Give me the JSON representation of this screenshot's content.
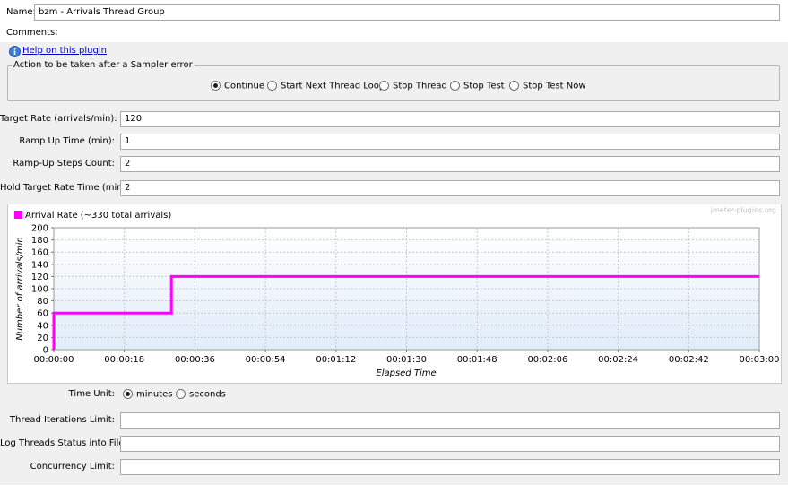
{
  "name": {
    "label": "Name:",
    "value": "bzm - Arrivals Thread Group"
  },
  "comments": {
    "label": "Comments:"
  },
  "help": {
    "link": "Help on this plugin"
  },
  "sampler_error": {
    "legend": "Action to be taken after a Sampler error",
    "options": [
      "Continue",
      "Start Next Thread Loop",
      "Stop Thread",
      "Stop Test",
      "Stop Test Now"
    ],
    "selected": "Continue"
  },
  "fields": {
    "target_rate": {
      "label": "Target Rate (arrivals/min):",
      "value": "120"
    },
    "ramp_up_time": {
      "label": "Ramp Up Time (min):",
      "value": "1"
    },
    "ramp_up_steps": {
      "label": "Ramp-Up Steps Count:",
      "value": "2"
    },
    "hold_time": {
      "label": "Hold Target Rate Time (min):",
      "value": "2"
    }
  },
  "chart": {
    "watermark": "jmeter-plugins.org"
  },
  "chart_data": {
    "type": "line",
    "legend": "Arrival Rate (~330 total arrivals)",
    "ylabel": "Number of arrivals/min",
    "xlabel": "Elapsed Time",
    "y_ticks": [
      "0",
      "20",
      "40",
      "60",
      "80",
      "100",
      "120",
      "140",
      "160",
      "180",
      "200"
    ],
    "x_ticks": [
      "00:00:00",
      "00:00:18",
      "00:00:36",
      "00:00:54",
      "00:01:12",
      "00:01:30",
      "00:01:48",
      "00:02:06",
      "00:02:24",
      "00:02:42",
      "00:03:00"
    ],
    "ylim": [
      0,
      200
    ],
    "xlim_seconds": [
      0,
      180
    ],
    "color": "#ff00ff",
    "series": [
      {
        "x_seconds": [
          0,
          0,
          30,
          30,
          180
        ],
        "values": [
          0,
          60,
          60,
          120,
          120
        ]
      }
    ]
  },
  "time_unit": {
    "label": "Time Unit:",
    "options": [
      "minutes",
      "seconds"
    ],
    "selected": "minutes"
  },
  "bottom_fields": {
    "iterations": {
      "label": "Thread Iterations Limit:",
      "value": ""
    },
    "log_threads": {
      "label": "Log Threads Status into File:",
      "value": ""
    },
    "concurrency": {
      "label": "Concurrency Limit:",
      "value": ""
    }
  }
}
